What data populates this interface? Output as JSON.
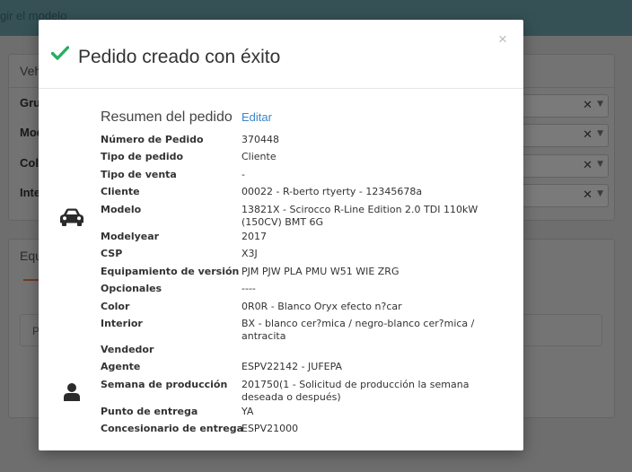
{
  "background": {
    "topbar_text": "gir el modelo",
    "vehicle_panel": {
      "title": "Veh",
      "fields": [
        "Gru",
        "Mod",
        "Col",
        "Inte"
      ]
    },
    "equipment_panel": {
      "title": "Equ",
      "box_text": "P"
    }
  },
  "modal": {
    "title": "Pedido creado con éxito",
    "close": "×",
    "summary_title": "Resumen del pedido",
    "edit_label": "Editar",
    "rows": [
      {
        "label": "Número de Pedido",
        "value": "370448"
      },
      {
        "label": "Tipo de pedido",
        "value": "Cliente"
      },
      {
        "label": "Tipo de venta",
        "value": "-"
      },
      {
        "label": "Cliente",
        "value": "00022 - R-berto rtyerty - 12345678a"
      },
      {
        "label": "Modelo",
        "value": "13821X - Scirocco R-Line Edition 2.0 TDI 110kW (150CV) BMT 6G"
      },
      {
        "label": "Modelyear",
        "value": "2017"
      },
      {
        "label": "CSP",
        "value": "X3J"
      },
      {
        "label": "Equipamiento de versión",
        "value": "PJM PJW PLA PMU W51 WIE ZRG"
      },
      {
        "label": "Opcionales",
        "value": "----"
      },
      {
        "label": "Color",
        "value": "0R0R - Blanco Oryx efecto n?car"
      },
      {
        "label": "Interior",
        "value": "BX - blanco cer?mica / negro-blanco cer?mica / antracita"
      },
      {
        "label": "Vendedor",
        "value": ""
      },
      {
        "label": "Agente",
        "value": "ESPV22142 - JUFEPA"
      },
      {
        "label": "Semana de producción",
        "value": "201750(1 - Solicitud de producción la semana deseada o después)"
      },
      {
        "label": "Punto de entrega",
        "value": "YA"
      },
      {
        "label": "Concesionario de entrega",
        "value": "ESPV21000"
      }
    ],
    "icons": {
      "success": "check-icon",
      "vehicle": "car-icon",
      "person": "person-icon"
    },
    "colors": {
      "success": "#27ae60",
      "link": "#3a87c8",
      "accent": "#e07a3c"
    }
  }
}
